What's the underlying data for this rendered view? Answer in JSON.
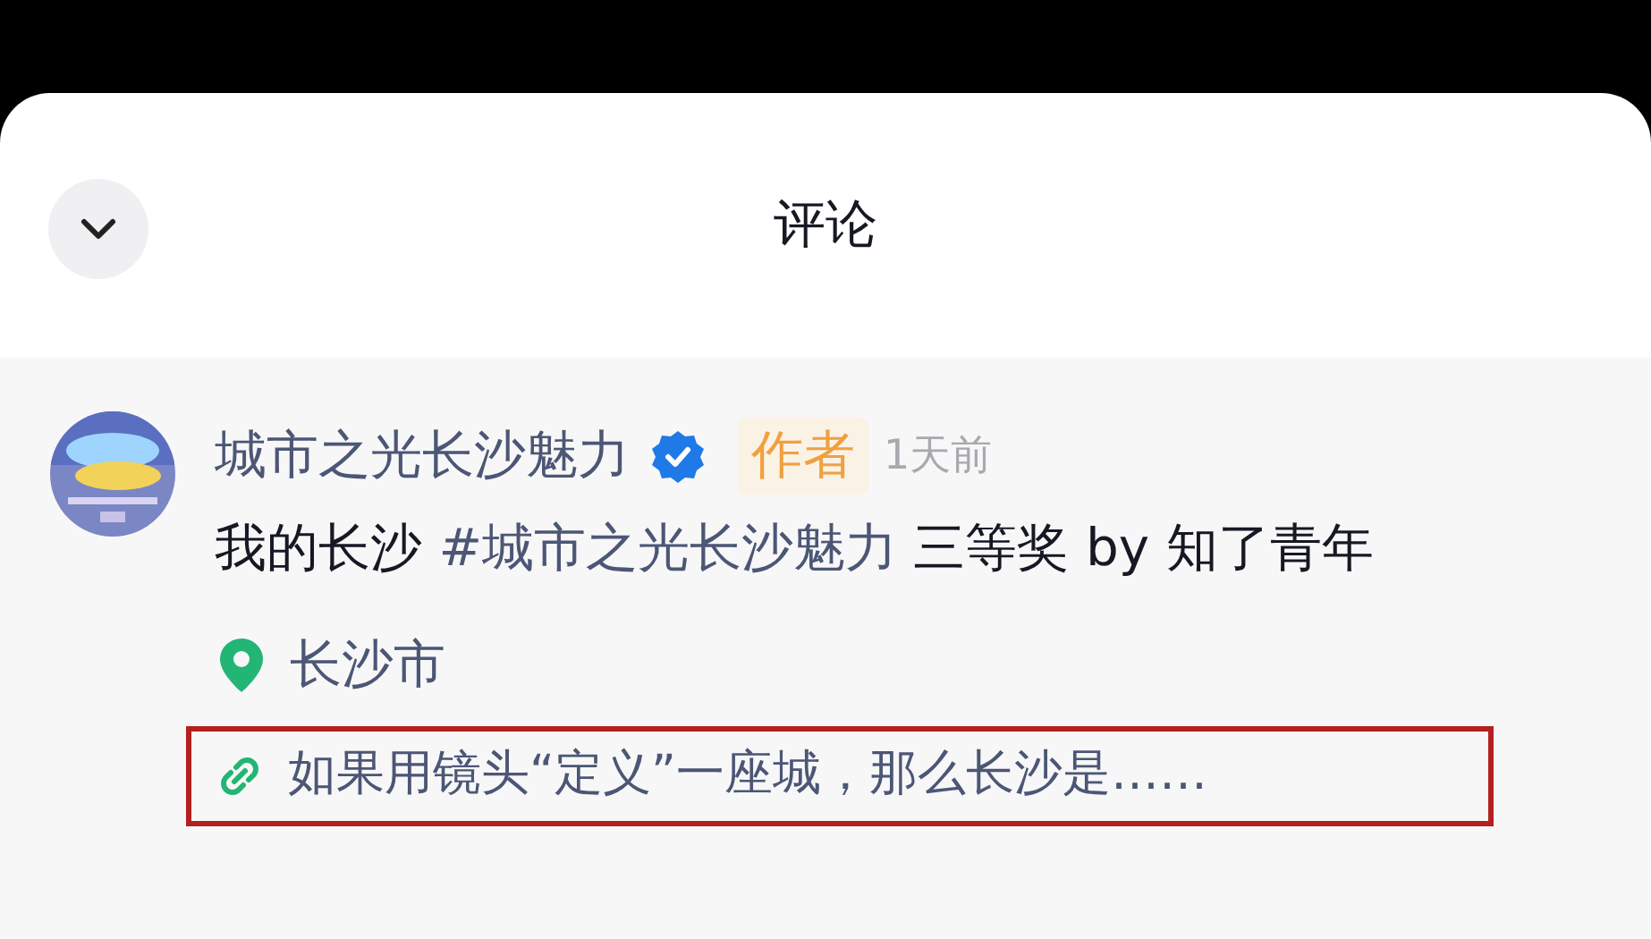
{
  "header": {
    "title": "评论"
  },
  "comment": {
    "author": "城市之光长沙魅力",
    "verified": true,
    "badge": "作者",
    "time": "1天前",
    "text": [
      {
        "kind": "plain",
        "text": "我的长沙 "
      },
      {
        "kind": "hashtag",
        "text": "#城市之光长沙魅力"
      },
      {
        "kind": "plain",
        "text": " 三等奖 by 知了青年"
      }
    ],
    "location": "长沙市",
    "link": {
      "text": "如果用镜头“定义”一座城，那么长沙是……",
      "highlighted": true
    }
  }
}
